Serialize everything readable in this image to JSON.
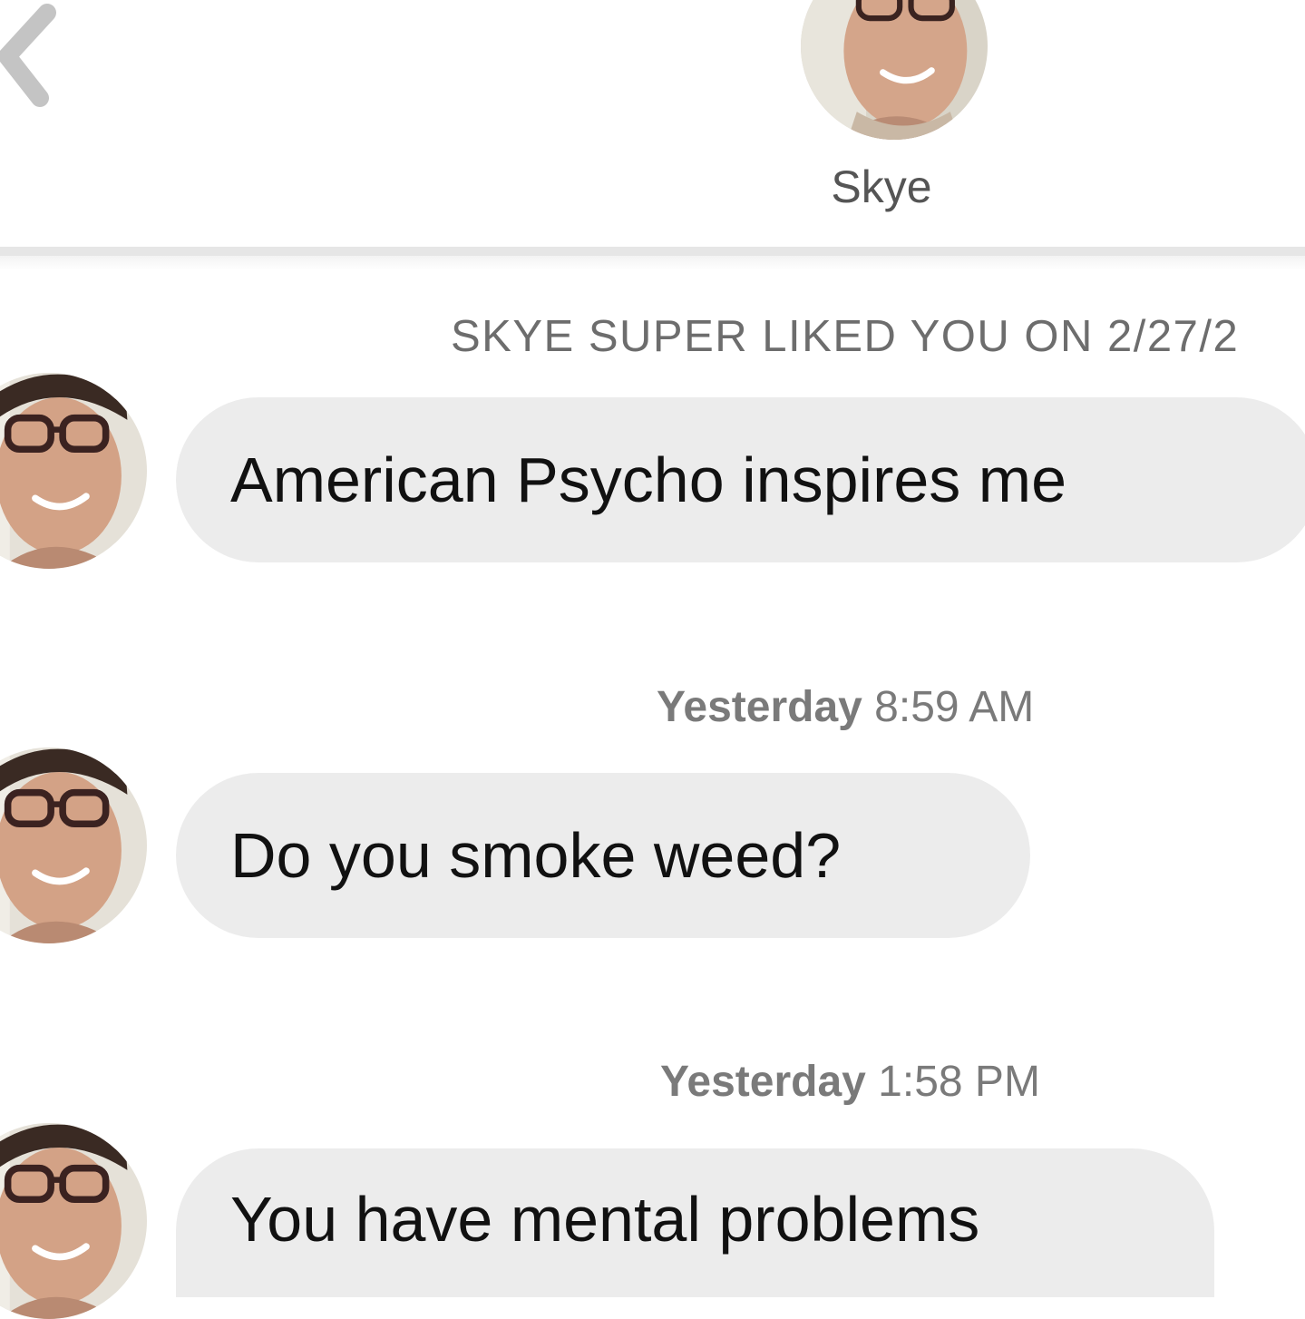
{
  "header": {
    "back_icon": "chevron-left-icon",
    "contact_name": "Skye",
    "avatar": "profile-photo"
  },
  "notice": {
    "super_like": "SKYE SUPER LIKED YOU ON 2/27/2"
  },
  "messages": [
    {
      "text": "American Psycho inspires me",
      "avatar": "profile-photo"
    },
    {
      "timestamp_day": "Yesterday",
      "timestamp_time": "8:59 AM",
      "text": "Do you smoke weed?",
      "avatar": "profile-photo"
    },
    {
      "timestamp_day": "Yesterday",
      "timestamp_time": "1:58 PM",
      "text": "You have mental problems",
      "avatar": "profile-photo"
    }
  ],
  "colors": {
    "bubble": "#ececec",
    "divider": "#e6e6e6",
    "muted_text": "#7a7a7a"
  }
}
